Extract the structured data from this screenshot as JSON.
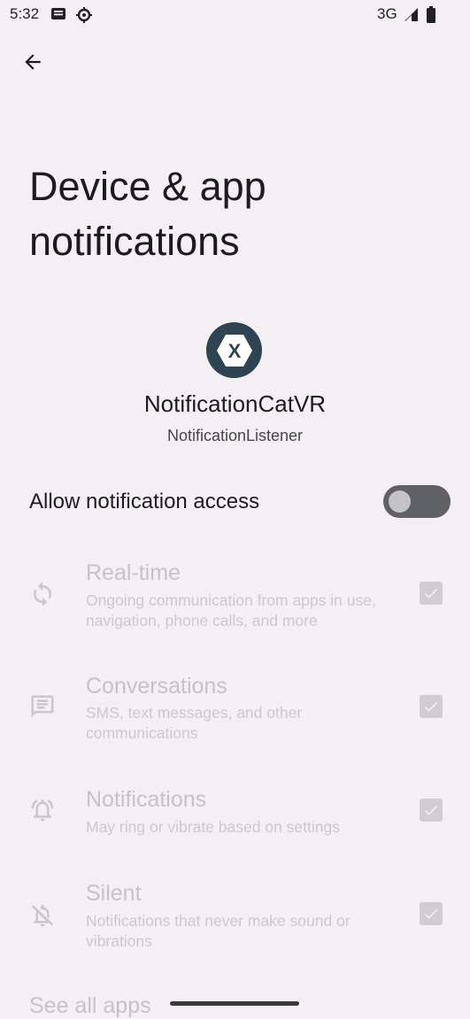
{
  "status_bar": {
    "time": "5:32",
    "network": "3G"
  },
  "header": {
    "title": "Device & app notifications"
  },
  "app": {
    "name": "NotificationCatVR",
    "subtitle": "NotificationListener",
    "icon_letter": "X"
  },
  "access": {
    "label": "Allow notification access",
    "enabled": false
  },
  "preferences": [
    {
      "title": "Real-time",
      "description": "Ongoing communication from apps in use, navigation, phone calls, and more",
      "icon": "sync-icon",
      "checked": true
    },
    {
      "title": "Conversations",
      "description": "SMS, text messages, and other communications",
      "icon": "chat-icon",
      "checked": true
    },
    {
      "title": "Notifications",
      "description": "May ring or vibrate based on settings",
      "icon": "ringing-bell-icon",
      "checked": true
    },
    {
      "title": "Silent",
      "description": "Notifications that never make sound or vibrations",
      "icon": "bell-off-icon",
      "checked": true
    }
  ],
  "footer": {
    "see_all": "See all apps"
  }
}
